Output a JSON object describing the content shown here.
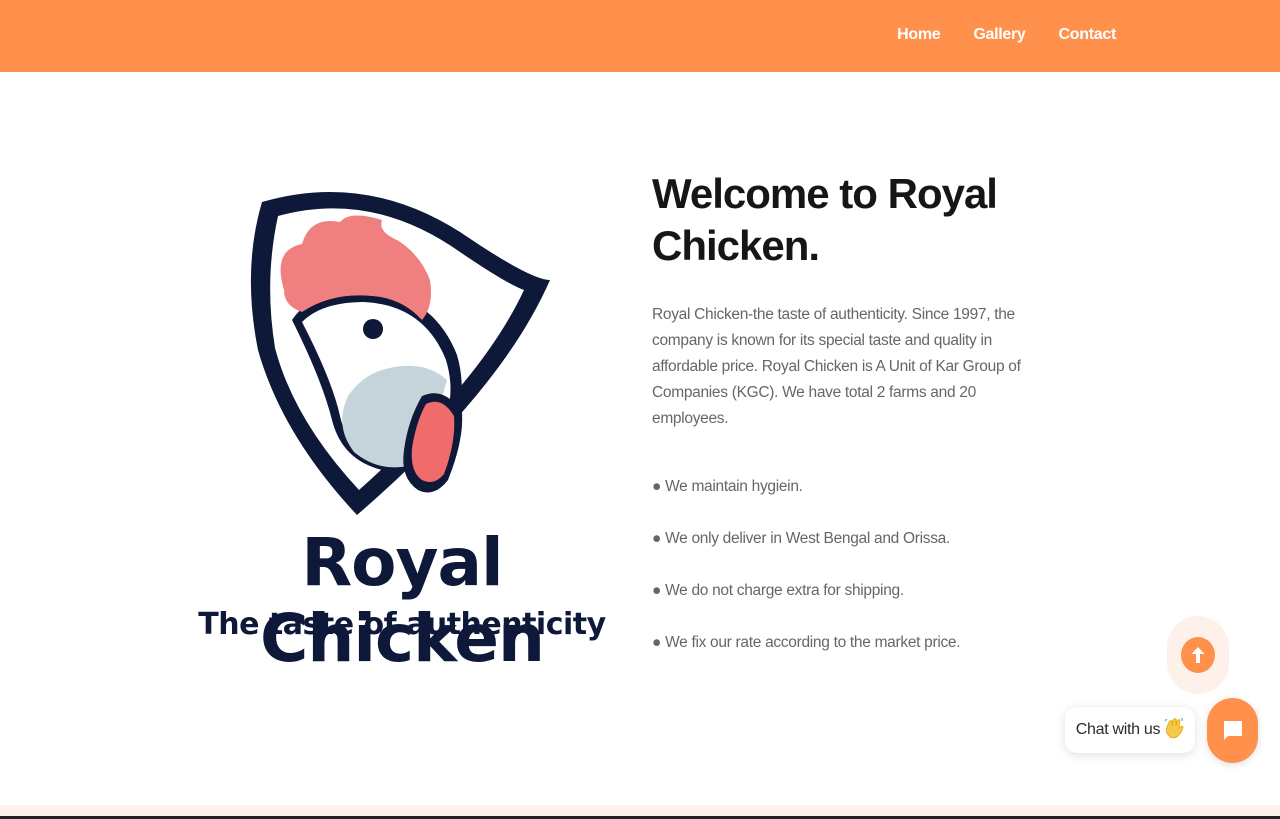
{
  "header": {
    "nav": [
      {
        "label": "Home"
      },
      {
        "label": "Gallery"
      },
      {
        "label": "Contact"
      }
    ]
  },
  "logo": {
    "title": "Royal Chicken",
    "tagline": "The taste of authenticity"
  },
  "main": {
    "heading": "Welcome to Royal Chicken.",
    "intro": "Royal Chicken-the taste of authenticity. Since 1997, the company is known for its special taste and quality in affordable price. Royal Chicken is A Unit of Kar Group of Companies (KGC). We have total 2 farms and 20 employees.",
    "bullet_char": "●",
    "features": [
      "We maintain hygiein.",
      "We only deliver in West Bengal and Orissa.",
      "We do not charge extra for shipping.",
      "We fix our rate according to the market price."
    ]
  },
  "widgets": {
    "chat_label": "Chat with us",
    "chat_icon": "chat-bubble-icon",
    "wave_icon": "waving-hand-icon",
    "scroll_icon": "arrow-up-icon"
  },
  "colors": {
    "accent": "#ff914d",
    "logo_navy": "#0e1838",
    "comb": "#f08080",
    "wattle": "#f06b6b",
    "cheek": "#c5d3da"
  }
}
